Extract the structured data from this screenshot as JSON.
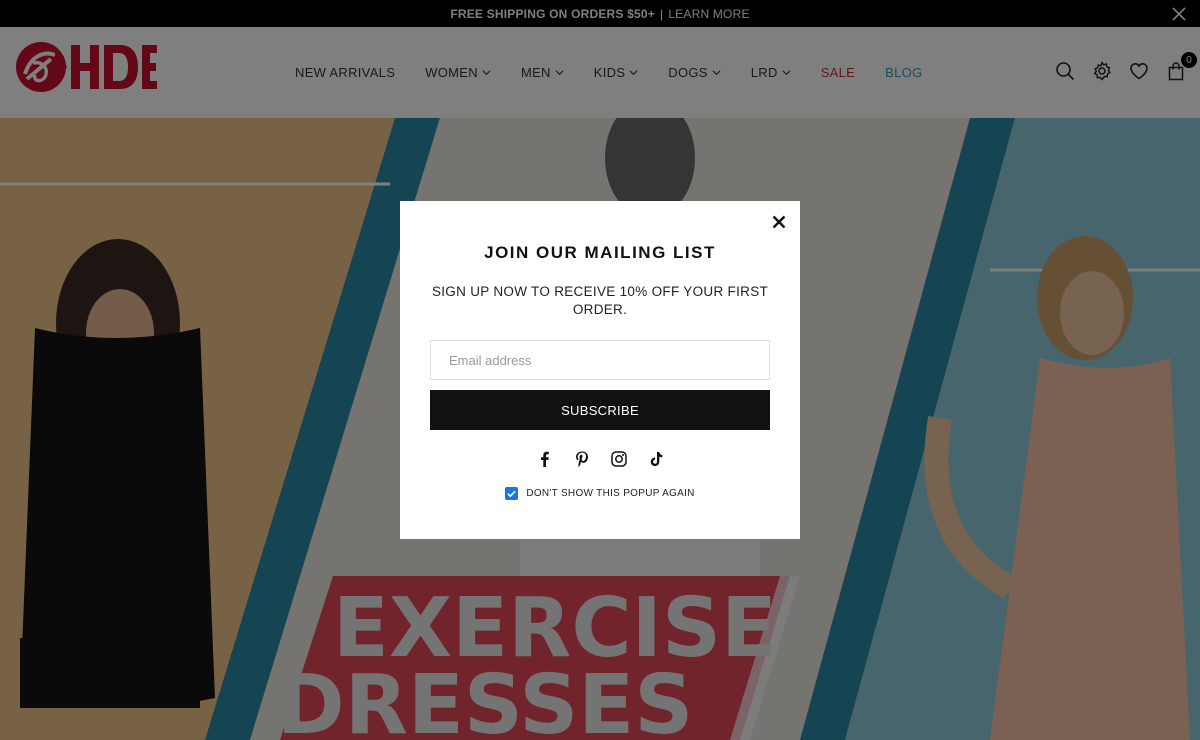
{
  "announcement": {
    "text": "FREE SHIPPING ON ORDERS $50+",
    "separator": "|",
    "link": "LEARN MORE"
  },
  "brand": {
    "name": "HDE",
    "color": "#c8102e"
  },
  "nav": [
    {
      "label": "NEW ARRIVALS",
      "dropdown": false
    },
    {
      "label": "WOMEN",
      "dropdown": true
    },
    {
      "label": "MEN",
      "dropdown": true
    },
    {
      "label": "KIDS",
      "dropdown": true
    },
    {
      "label": "DOGS",
      "dropdown": true
    },
    {
      "label": "LRD",
      "dropdown": true
    },
    {
      "label": "SALE",
      "dropdown": false,
      "color": "#c0302f"
    },
    {
      "label": "BLOG",
      "dropdown": false,
      "color": "#3a94b8"
    }
  ],
  "header_icons": [
    "search-icon",
    "gear-icon",
    "heart-icon",
    "shopping-bag-icon"
  ],
  "cart_count": "0",
  "hero": {
    "line1": "EXERCISE",
    "line2": "DRESSES",
    "accent_color": "#1f7c96",
    "banner_color": "#d93040"
  },
  "popup": {
    "title": "JOIN OUR MAILING LIST",
    "subtitle": "SIGN UP NOW TO RECEIVE 10% OFF YOUR FIRST ORDER.",
    "email_placeholder": "Email address",
    "subscribe_label": "SUBSCRIBE",
    "social_icons": [
      "facebook-icon",
      "pinterest-icon",
      "instagram-icon",
      "tiktok-icon"
    ],
    "dont_show_label": "DON'T SHOW THIS POPUP AGAIN",
    "dont_show_checked": true
  }
}
